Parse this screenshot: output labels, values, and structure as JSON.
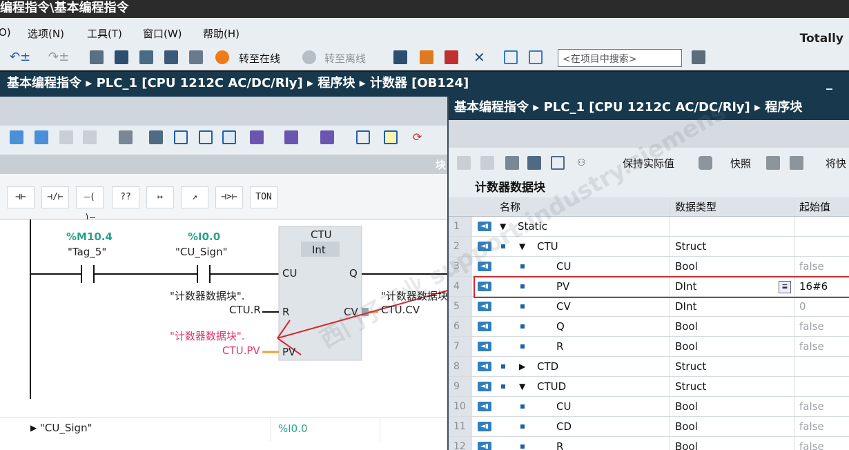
{
  "title": "编程指令\\基本编程指令",
  "menu": {
    "cut": "O)",
    "items": [
      "选项(N)",
      "工具(T)",
      "窗口(W)",
      "帮助(H)"
    ],
    "brand": "Totally"
  },
  "toolbar": {
    "go_online": "转至在线",
    "go_offline": "转至离线",
    "search_placeholder": "<在项目中搜索>"
  },
  "editor": {
    "breadcrumb": "基本编程指令 ▸ PLC_1 [CPU 1212C AC/DC/Rly] ▸ 程序块 ▸ 计数器 [OB124]",
    "minimize": "_",
    "block_label": "块",
    "ladder_buttons": [
      "⊣⊢",
      "⊣/⊢",
      "–( )–",
      "??",
      "↦",
      "↗",
      "⊣>⊢",
      "TON"
    ]
  },
  "network": {
    "contact1_addr": "%M10.4",
    "contact1_tag": "\"Tag_5\"",
    "contact2_addr": "%I0.0",
    "contact2_tag": "\"CU_Sign\"",
    "block_name": "CTU",
    "block_type": "Int",
    "pin_cu": "CU",
    "pin_q": "Q",
    "pin_r": "R",
    "pin_cv": "CV",
    "pin_pv": "PV",
    "r_tag_line1": "\"计数器数据块\".",
    "r_tag_line2": "CTU.R",
    "cv_tag_line1": "\"计数器数据块",
    "cv_tag_line2": "CTU.CV",
    "pv_tag_line1": "\"计数器数据块\".",
    "pv_tag_line2": "CTU.PV",
    "bottom_tag": "\"CU_Sign\"",
    "bottom_addr": "%I0.0"
  },
  "db": {
    "breadcrumb": "基本编程指令 ▸ PLC_1 [CPU 1212C AC/DC/Rly] ▸ 程序块",
    "keep_actual": "保持实际值",
    "snapshot": "快照",
    "more": "将快",
    "name": "计数器数据块",
    "columns": [
      "名称",
      "数据类型",
      "起始值"
    ],
    "rows": [
      {
        "num": "1",
        "level": 0,
        "expand": "▼",
        "name": "Static",
        "type": "",
        "start": ""
      },
      {
        "num": "2",
        "level": 1,
        "expand": "▼",
        "name": "CTU",
        "type": "Struct",
        "start": ""
      },
      {
        "num": "3",
        "level": 2,
        "expand": "",
        "name": "CU",
        "type": "Bool",
        "start": "false"
      },
      {
        "num": "4",
        "level": 2,
        "expand": "",
        "name": "PV",
        "type": "DInt",
        "start": "16#6"
      },
      {
        "num": "5",
        "level": 2,
        "expand": "",
        "name": "CV",
        "type": "DInt",
        "start": "0"
      },
      {
        "num": "6",
        "level": 2,
        "expand": "",
        "name": "Q",
        "type": "Bool",
        "start": "false"
      },
      {
        "num": "7",
        "level": 2,
        "expand": "",
        "name": "R",
        "type": "Bool",
        "start": "false"
      },
      {
        "num": "8",
        "level": 1,
        "expand": "▶",
        "name": "CTD",
        "type": "Struct",
        "start": ""
      },
      {
        "num": "9",
        "level": 1,
        "expand": "▼",
        "name": "CTUD",
        "type": "Struct",
        "start": ""
      },
      {
        "num": "10",
        "level": 2,
        "expand": "",
        "name": "CU",
        "type": "Bool",
        "start": "false"
      },
      {
        "num": "11",
        "level": 2,
        "expand": "",
        "name": "CD",
        "type": "Bool",
        "start": "false"
      },
      {
        "num": "12",
        "level": 2,
        "expand": "",
        "name": "R",
        "type": "Bool",
        "start": "false"
      }
    ]
  },
  "colors": {
    "accent_red": "#d6282f",
    "address_green": "#2aa28a",
    "tag_pink": "#e0336b",
    "titlebar_blue": "#17384d"
  }
}
